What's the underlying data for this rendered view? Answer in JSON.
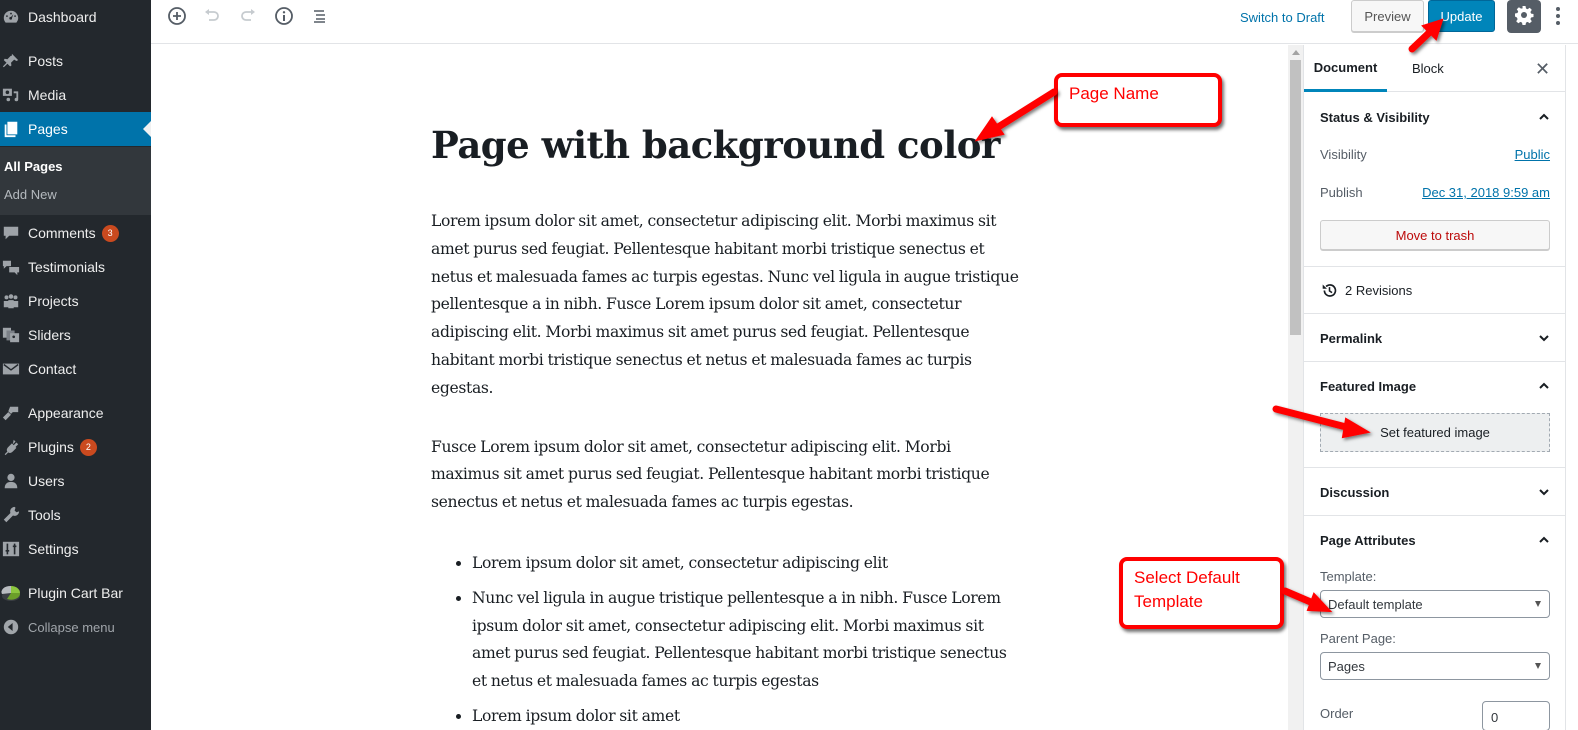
{
  "sidebar": {
    "items": [
      {
        "label": "Dashboard",
        "icon": "dashboard-icon"
      },
      {
        "label": "Posts",
        "icon": "pin-icon"
      },
      {
        "label": "Media",
        "icon": "media-icon"
      },
      {
        "label": "Pages",
        "icon": "pages-icon",
        "active": true
      },
      {
        "label": "Comments",
        "icon": "comment-icon",
        "badge": "3"
      },
      {
        "label": "Testimonials",
        "icon": "testimonials-icon"
      },
      {
        "label": "Projects",
        "icon": "projects-icon"
      },
      {
        "label": "Sliders",
        "icon": "sliders-icon"
      },
      {
        "label": "Contact",
        "icon": "mail-icon"
      },
      {
        "label": "Appearance",
        "icon": "paintbrush-icon"
      },
      {
        "label": "Plugins",
        "icon": "plugin-icon",
        "badge": "2"
      },
      {
        "label": "Users",
        "icon": "user-icon"
      },
      {
        "label": "Tools",
        "icon": "wrench-icon"
      },
      {
        "label": "Settings",
        "icon": "settings-sliders-icon"
      },
      {
        "label": "Plugin Cart Bar",
        "icon": "pie-chart-icon"
      }
    ],
    "submenu": {
      "current": "All Pages",
      "other": "Add New"
    },
    "collapse_label": "Collapse menu"
  },
  "toolbar": {
    "add_block_icon": "plus-circle-icon",
    "undo_icon": "undo-icon",
    "redo_icon": "redo-icon",
    "info_icon": "info-icon",
    "outline_icon": "list-icon",
    "switch_to_draft": "Switch to Draft",
    "preview": "Preview",
    "update": "Update",
    "settings_icon": "gear-icon",
    "more_icon": "more-vertical-icon"
  },
  "editor": {
    "title": "Page with background color",
    "paragraphs": [
      "Lorem ipsum dolor sit amet, consectetur adipiscing elit. Morbi maximus sit amet purus sed feugiat. Pellentesque habitant morbi tristique senectus et netus et malesuada fames ac turpis egestas. Nunc vel ligula in augue tristique pellentesque a in nibh. Fusce Lorem ipsum dolor sit amet, consectetur adipiscing elit. Morbi maximus sit amet purus sed feugiat. Pellentesque habitant morbi tristique senectus et netus et malesuada fames ac turpis egestas.",
      "Fusce Lorem ipsum dolor sit amet, consectetur adipiscing elit. Morbi maximus sit amet purus sed feugiat. Pellentesque habitant morbi tristique senectus et netus et malesuada fames ac turpis egestas."
    ],
    "list": [
      "Lorem ipsum dolor sit amet, consectetur adipiscing elit",
      "Nunc vel ligula in augue tristique pellentesque a in nibh. Fusce Lorem ipsum dolor sit amet, consectetur adipiscing elit. Morbi maximus sit amet purus sed feugiat. Pellentesque habitant morbi tristique senectus et netus et malesuada fames ac turpis egestas",
      "Lorem ipsum dolor sit amet"
    ]
  },
  "settings_panel": {
    "tabs": [
      {
        "label": "Document",
        "active": true
      },
      {
        "label": "Block"
      }
    ],
    "close_icon": "close-icon",
    "status": {
      "title": "Status & Visibility",
      "visibility_label": "Visibility",
      "visibility_value": "Public",
      "publish_label": "Publish",
      "publish_value": "Dec 31, 2018 9:59 am",
      "trash": "Move to trash"
    },
    "revisions": {
      "label": "2 Revisions",
      "icon": "history-icon"
    },
    "permalink": {
      "title": "Permalink"
    },
    "featured_image": {
      "title": "Featured Image",
      "button": "Set featured image"
    },
    "discussion": {
      "title": "Discussion"
    },
    "page_attributes": {
      "title": "Page Attributes",
      "template_label": "Template:",
      "template_value": "Default template",
      "parent_label": "Parent Page:",
      "parent_value": "Pages",
      "order_label": "Order",
      "order_value": "0"
    }
  },
  "annotations": {
    "page_name": "Page Name",
    "select_template_line1": "Select Default",
    "select_template_line2": "Template",
    "color": "#ff0000"
  },
  "colors": {
    "admin_bg": "#23282d",
    "admin_active": "#0073aa",
    "update_button": "#0085ba",
    "badge": "#ca4a1f",
    "link": "#0073aa",
    "trash": "#bc0b0b"
  }
}
